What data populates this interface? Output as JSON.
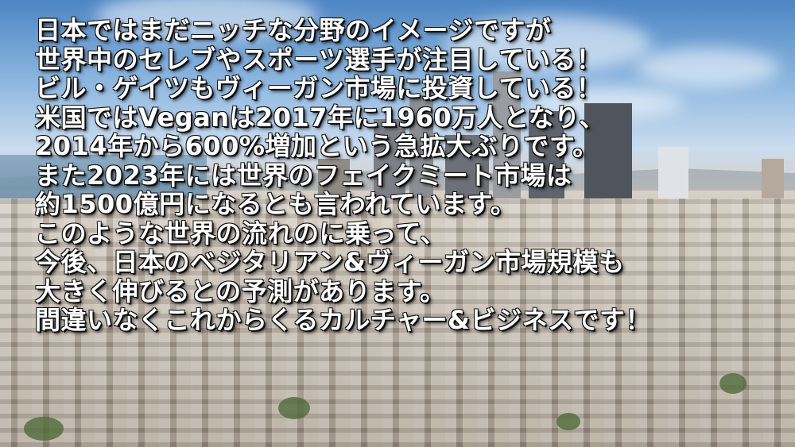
{
  "colors": {
    "text": "#ffffff",
    "text_outline": "#111111",
    "sky_top": "#4d86c4",
    "sky_bottom": "#c9dcef"
  },
  "message": {
    "lines": [
      "日本ではまだニッチな分野のイメージですが",
      "世界中のセレブやスポーツ選手が注目している！",
      "ビル・ゲイツもヴィーガン市場に投資している！",
      "米国ではVeganは2017年に1960万人となり、",
      "2014年から600%増加という急拡大ぶりです。",
      "また2023年には世界のフェイクミート市場は",
      "約1500億円になるとも言われています。",
      "このような世界の流れのに乗って、",
      "今後、日本のベジタリアン&ヴィーガン市場規模も",
      "大きく伸びるとの予測があります。",
      "間違いなくこれからくるカルチャー&ビジネスです！"
    ]
  }
}
